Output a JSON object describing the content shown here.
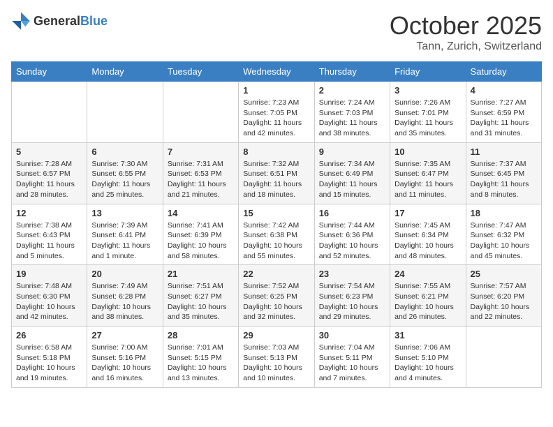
{
  "header": {
    "logo_general": "General",
    "logo_blue": "Blue",
    "month_title": "October 2025",
    "location": "Tann, Zurich, Switzerland"
  },
  "weekdays": [
    "Sunday",
    "Monday",
    "Tuesday",
    "Wednesday",
    "Thursday",
    "Friday",
    "Saturday"
  ],
  "weeks": [
    [
      null,
      null,
      null,
      {
        "day": "1",
        "sunrise": "7:23 AM",
        "sunset": "7:05 PM",
        "daylight": "11 hours and 42 minutes."
      },
      {
        "day": "2",
        "sunrise": "7:24 AM",
        "sunset": "7:03 PM",
        "daylight": "11 hours and 38 minutes."
      },
      {
        "day": "3",
        "sunrise": "7:26 AM",
        "sunset": "7:01 PM",
        "daylight": "11 hours and 35 minutes."
      },
      {
        "day": "4",
        "sunrise": "7:27 AM",
        "sunset": "6:59 PM",
        "daylight": "11 hours and 31 minutes."
      }
    ],
    [
      {
        "day": "5",
        "sunrise": "7:28 AM",
        "sunset": "6:57 PM",
        "daylight": "11 hours and 28 minutes."
      },
      {
        "day": "6",
        "sunrise": "7:30 AM",
        "sunset": "6:55 PM",
        "daylight": "11 hours and 25 minutes."
      },
      {
        "day": "7",
        "sunrise": "7:31 AM",
        "sunset": "6:53 PM",
        "daylight": "11 hours and 21 minutes."
      },
      {
        "day": "8",
        "sunrise": "7:32 AM",
        "sunset": "6:51 PM",
        "daylight": "11 hours and 18 minutes."
      },
      {
        "day": "9",
        "sunrise": "7:34 AM",
        "sunset": "6:49 PM",
        "daylight": "11 hours and 15 minutes."
      },
      {
        "day": "10",
        "sunrise": "7:35 AM",
        "sunset": "6:47 PM",
        "daylight": "11 hours and 11 minutes."
      },
      {
        "day": "11",
        "sunrise": "7:37 AM",
        "sunset": "6:45 PM",
        "daylight": "11 hours and 8 minutes."
      }
    ],
    [
      {
        "day": "12",
        "sunrise": "7:38 AM",
        "sunset": "6:43 PM",
        "daylight": "11 hours and 5 minutes."
      },
      {
        "day": "13",
        "sunrise": "7:39 AM",
        "sunset": "6:41 PM",
        "daylight": "11 hours and 1 minute."
      },
      {
        "day": "14",
        "sunrise": "7:41 AM",
        "sunset": "6:39 PM",
        "daylight": "10 hours and 58 minutes."
      },
      {
        "day": "15",
        "sunrise": "7:42 AM",
        "sunset": "6:38 PM",
        "daylight": "10 hours and 55 minutes."
      },
      {
        "day": "16",
        "sunrise": "7:44 AM",
        "sunset": "6:36 PM",
        "daylight": "10 hours and 52 minutes."
      },
      {
        "day": "17",
        "sunrise": "7:45 AM",
        "sunset": "6:34 PM",
        "daylight": "10 hours and 48 minutes."
      },
      {
        "day": "18",
        "sunrise": "7:47 AM",
        "sunset": "6:32 PM",
        "daylight": "10 hours and 45 minutes."
      }
    ],
    [
      {
        "day": "19",
        "sunrise": "7:48 AM",
        "sunset": "6:30 PM",
        "daylight": "10 hours and 42 minutes."
      },
      {
        "day": "20",
        "sunrise": "7:49 AM",
        "sunset": "6:28 PM",
        "daylight": "10 hours and 38 minutes."
      },
      {
        "day": "21",
        "sunrise": "7:51 AM",
        "sunset": "6:27 PM",
        "daylight": "10 hours and 35 minutes."
      },
      {
        "day": "22",
        "sunrise": "7:52 AM",
        "sunset": "6:25 PM",
        "daylight": "10 hours and 32 minutes."
      },
      {
        "day": "23",
        "sunrise": "7:54 AM",
        "sunset": "6:23 PM",
        "daylight": "10 hours and 29 minutes."
      },
      {
        "day": "24",
        "sunrise": "7:55 AM",
        "sunset": "6:21 PM",
        "daylight": "10 hours and 26 minutes."
      },
      {
        "day": "25",
        "sunrise": "7:57 AM",
        "sunset": "6:20 PM",
        "daylight": "10 hours and 22 minutes."
      }
    ],
    [
      {
        "day": "26",
        "sunrise": "6:58 AM",
        "sunset": "5:18 PM",
        "daylight": "10 hours and 19 minutes."
      },
      {
        "day": "27",
        "sunrise": "7:00 AM",
        "sunset": "5:16 PM",
        "daylight": "10 hours and 16 minutes."
      },
      {
        "day": "28",
        "sunrise": "7:01 AM",
        "sunset": "5:15 PM",
        "daylight": "10 hours and 13 minutes."
      },
      {
        "day": "29",
        "sunrise": "7:03 AM",
        "sunset": "5:13 PM",
        "daylight": "10 hours and 10 minutes."
      },
      {
        "day": "30",
        "sunrise": "7:04 AM",
        "sunset": "5:11 PM",
        "daylight": "10 hours and 7 minutes."
      },
      {
        "day": "31",
        "sunrise": "7:06 AM",
        "sunset": "5:10 PM",
        "daylight": "10 hours and 4 minutes."
      },
      null
    ]
  ],
  "labels": {
    "sunrise": "Sunrise:",
    "sunset": "Sunset:",
    "daylight": "Daylight:"
  }
}
